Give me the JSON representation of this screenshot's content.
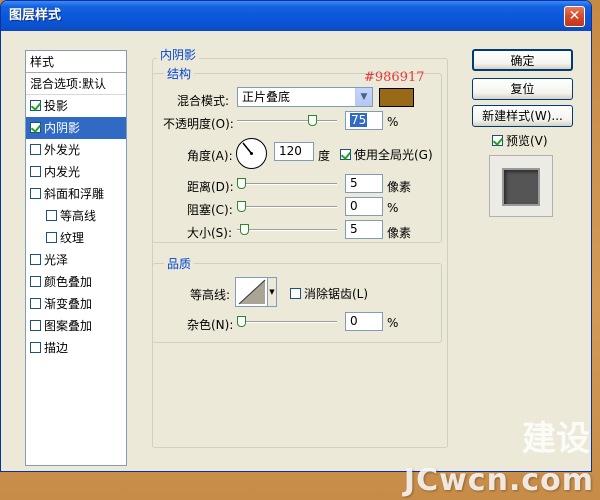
{
  "window": {
    "title": "图层样式",
    "close_label": "✕"
  },
  "sidebar": {
    "header": "样式",
    "items": [
      {
        "label": "混合选项:默认",
        "checkbox": false,
        "checked": false,
        "indent": false,
        "selected": false
      },
      {
        "label": "投影",
        "checkbox": true,
        "checked": true,
        "indent": false,
        "selected": false
      },
      {
        "label": "内阴影",
        "checkbox": true,
        "checked": true,
        "indent": false,
        "selected": true
      },
      {
        "label": "外发光",
        "checkbox": true,
        "checked": false,
        "indent": false,
        "selected": false
      },
      {
        "label": "内发光",
        "checkbox": true,
        "checked": false,
        "indent": false,
        "selected": false
      },
      {
        "label": "斜面和浮雕",
        "checkbox": true,
        "checked": false,
        "indent": false,
        "selected": false
      },
      {
        "label": "等高线",
        "checkbox": true,
        "checked": false,
        "indent": true,
        "selected": false
      },
      {
        "label": "纹理",
        "checkbox": true,
        "checked": false,
        "indent": true,
        "selected": false
      },
      {
        "label": "光泽",
        "checkbox": true,
        "checked": false,
        "indent": false,
        "selected": false
      },
      {
        "label": "颜色叠加",
        "checkbox": true,
        "checked": false,
        "indent": false,
        "selected": false
      },
      {
        "label": "渐变叠加",
        "checkbox": true,
        "checked": false,
        "indent": false,
        "selected": false
      },
      {
        "label": "图案叠加",
        "checkbox": true,
        "checked": false,
        "indent": false,
        "selected": false
      },
      {
        "label": "描边",
        "checkbox": true,
        "checked": false,
        "indent": false,
        "selected": false
      }
    ]
  },
  "main": {
    "section_title": "内阴影",
    "structure": {
      "title": "结构",
      "annotation": "#986917",
      "blend_mode_label": "混合模式:",
      "blend_mode_value": "正片叠底",
      "swatch_color": "#986917",
      "opacity_label": "不透明度(O):",
      "opacity_value": "75",
      "opacity_unit": "%",
      "opacity_fraction": 0.75,
      "angle_label": "角度(A):",
      "angle_value": "120",
      "angle_unit": "度",
      "global_light_label": "使用全局光(G)",
      "global_light_checked": true,
      "distance_label": "距离(D):",
      "distance_value": "5",
      "distance_unit": "像素",
      "choke_label": "阻塞(C):",
      "choke_value": "0",
      "choke_unit": "%",
      "size_label": "大小(S):",
      "size_value": "5",
      "size_unit": "像素"
    },
    "quality": {
      "title": "品质",
      "contour_label": "等高线:",
      "antialias_label": "消除锯齿(L)",
      "antialias_checked": false,
      "noise_label": "杂色(N):",
      "noise_value": "0",
      "noise_unit": "%"
    }
  },
  "buttons": {
    "ok": "确定",
    "reset": "复位",
    "new_style": "新建样式(W)...",
    "preview_label": "预览(V)",
    "preview_checked": true
  },
  "watermark": {
    "brand": "建设",
    "site": "JCwcn.com"
  }
}
